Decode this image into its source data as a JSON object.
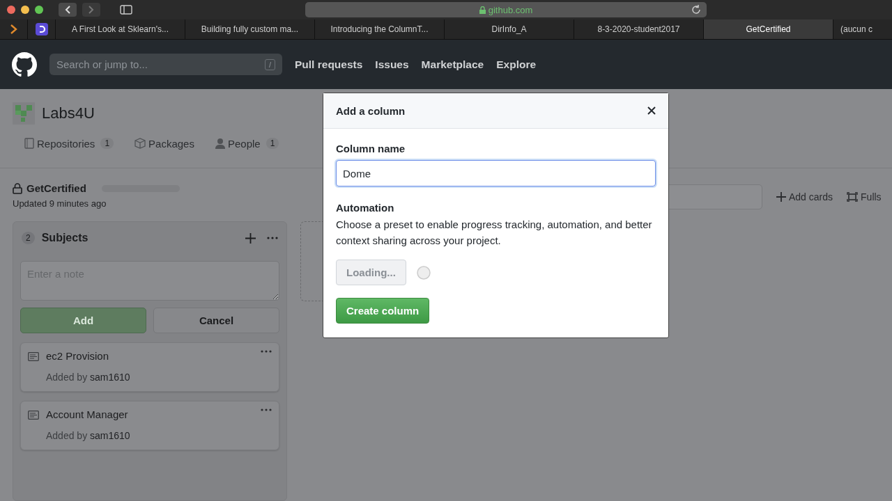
{
  "browser": {
    "url": "github.com",
    "tabs": [
      {
        "kind": "icon",
        "selected": false
      },
      {
        "kind": "icon",
        "selected": false
      },
      {
        "kind": "text",
        "title": "A First Look at Sklearn's...",
        "selected": false
      },
      {
        "kind": "text",
        "title": "Building fully custom ma...",
        "selected": false
      },
      {
        "kind": "text",
        "title": "Introducing the ColumnT...",
        "selected": false
      },
      {
        "kind": "text",
        "title": "DirInfo_A",
        "selected": false
      },
      {
        "kind": "text",
        "title": "8-3-2020-student2017",
        "selected": false
      },
      {
        "kind": "text",
        "title": "GetCertified",
        "selected": true
      },
      {
        "kind": "text",
        "title": "(aucun c",
        "selected": false
      }
    ]
  },
  "header": {
    "search": {
      "placeholder": "Search or jump to...",
      "key": "/"
    },
    "nav": [
      "Pull requests",
      "Issues",
      "Marketplace",
      "Explore"
    ]
  },
  "org": {
    "name": "Labs4U",
    "tabs": [
      {
        "kind": "repo",
        "label": "Repositories",
        "count": "1"
      },
      {
        "kind": "package",
        "label": "Packages"
      },
      {
        "kind": "people",
        "label": "People",
        "count": "1"
      }
    ]
  },
  "project": {
    "name": "GetCertified",
    "updated": "Updated 9 minutes ago",
    "progress": {
      "level": 0
    },
    "actions": [
      {
        "kind": "add",
        "label": "Add cards"
      },
      {
        "kind": "fullscreen",
        "label": "Fulls"
      }
    ]
  },
  "column": {
    "count": "2",
    "title": "Subjects",
    "note": {
      "placeholder": "Enter a note"
    },
    "add": {
      "label": "Add",
      "disabled": true
    },
    "cancel": "Cancel",
    "cards": [
      {
        "title": "ec2 Provision",
        "added_label": "Added by",
        "author": "sam1610"
      },
      {
        "title": "Account Manager",
        "added_label": "Added by",
        "author": "sam1610"
      }
    ]
  },
  "modal": {
    "title": "Add a column",
    "field_label": "Column name",
    "value": "Dome",
    "automation": "Automation",
    "description": "Choose a preset to enable progress tracking, automation, and better context sharing across your project.",
    "loading": {
      "label": "Loading...",
      "disabled": true
    },
    "create": "Create column"
  }
}
